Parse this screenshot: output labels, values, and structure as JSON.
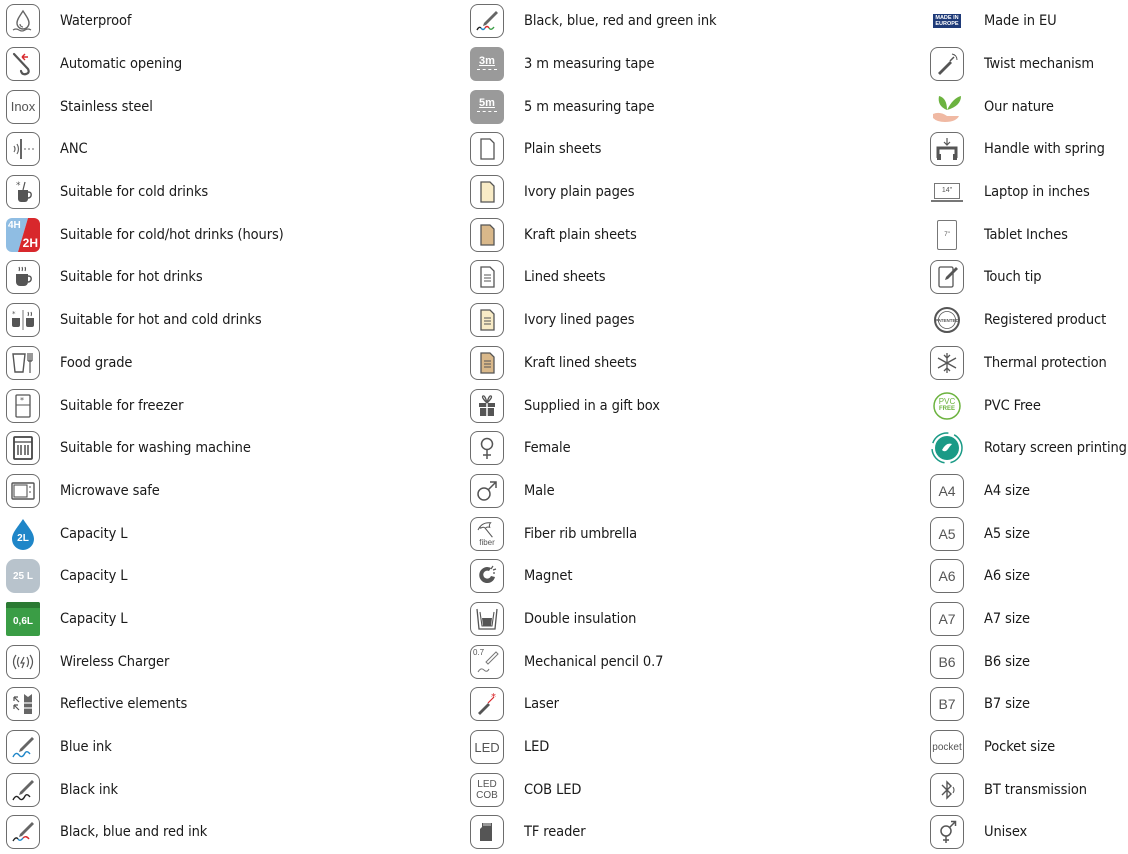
{
  "columns": [
    {
      "items": [
        {
          "icon": "water-drop-icon",
          "label": "Waterproof"
        },
        {
          "icon": "auto-open-umbrella-icon",
          "label": "Automatic opening"
        },
        {
          "icon": "inox-icon",
          "icon_text": "Inox",
          "label": "Stainless steel"
        },
        {
          "icon": "anc-icon",
          "label": "ANC"
        },
        {
          "icon": "cold-drink-icon",
          "label": "Suitable for cold drinks"
        },
        {
          "icon": "cold-hot-hours-icon",
          "icon_text_top": "4H",
          "icon_text_bottom": "2H",
          "label": "Suitable for cold/hot drinks (hours)"
        },
        {
          "icon": "hot-drink-icon",
          "label": "Suitable for hot drinks"
        },
        {
          "icon": "hot-cold-drink-icon",
          "label": "Suitable for hot and cold drinks"
        },
        {
          "icon": "food-grade-icon",
          "label": "Food grade"
        },
        {
          "icon": "freezer-icon",
          "label": "Suitable for freezer"
        },
        {
          "icon": "dishwasher-icon",
          "label": "Suitable for washing machine"
        },
        {
          "icon": "microwave-icon",
          "label": "Microwave safe"
        },
        {
          "icon": "capacity-drop-icon",
          "icon_text": "2L",
          "label": "Capacity L"
        },
        {
          "icon": "capacity-badge-icon",
          "icon_text": "25 L",
          "label": "Capacity L"
        },
        {
          "icon": "capacity-jar-icon",
          "icon_text": "0,6L",
          "label": "Capacity L"
        },
        {
          "icon": "wireless-charger-icon",
          "label": "Wireless Charger"
        },
        {
          "icon": "reflective-vest-icon",
          "label": "Reflective elements"
        },
        {
          "icon": "pen-blue-icon",
          "label": "Blue ink"
        },
        {
          "icon": "pen-black-icon",
          "label": "Black ink"
        },
        {
          "icon": "pen-multi-icon",
          "label": "Black, blue and red ink"
        }
      ]
    },
    {
      "items": [
        {
          "icon": "pen-four-color-icon",
          "label": "Black, blue, red and green ink"
        },
        {
          "icon": "tape-3m-icon",
          "icon_text": "3m",
          "label": "3 m measuring tape"
        },
        {
          "icon": "tape-5m-icon",
          "icon_text": "5m",
          "label": "5 m measuring tape"
        },
        {
          "icon": "plain-sheet-icon",
          "label": "Plain sheets"
        },
        {
          "icon": "ivory-plain-icon",
          "label": "Ivory plain pages"
        },
        {
          "icon": "kraft-plain-icon",
          "label": "Kraft plain sheets"
        },
        {
          "icon": "lined-sheet-icon",
          "label": "Lined sheets"
        },
        {
          "icon": "ivory-lined-icon",
          "label": "Ivory lined pages"
        },
        {
          "icon": "kraft-lined-icon",
          "label": "Kraft lined sheets"
        },
        {
          "icon": "gift-box-icon",
          "label": "Supplied in a gift box"
        },
        {
          "icon": "female-icon",
          "label": "Female"
        },
        {
          "icon": "male-icon",
          "label": "Male"
        },
        {
          "icon": "fiber-umbrella-icon",
          "icon_text": "fiber",
          "label": "Fiber rib umbrella"
        },
        {
          "icon": "magnet-icon",
          "label": "Magnet"
        },
        {
          "icon": "double-insulation-icon",
          "label": "Double insulation"
        },
        {
          "icon": "mechanical-pencil-icon",
          "icon_text": "0.7",
          "label": "Mechanical pencil 0.7"
        },
        {
          "icon": "laser-icon",
          "label": "Laser"
        },
        {
          "icon": "led-icon",
          "icon_text": "LED",
          "label": "LED"
        },
        {
          "icon": "cob-led-icon",
          "icon_text_top": "LED",
          "icon_text_bottom": "COB",
          "label": "COB LED"
        },
        {
          "icon": "tf-card-icon",
          "label": "TF reader"
        }
      ]
    },
    {
      "items": [
        {
          "icon": "made-in-europe-icon",
          "icon_text_top": "MADE IN",
          "icon_text_bottom": "EUROPE",
          "label": "Made in EU"
        },
        {
          "icon": "twist-pen-icon",
          "label": "Twist mechanism"
        },
        {
          "icon": "nature-leaf-icon",
          "label": "Our nature"
        },
        {
          "icon": "handle-spring-icon",
          "label": "Handle with spring"
        },
        {
          "icon": "laptop-inch-icon",
          "icon_text": "14\"",
          "label": "Laptop in inches"
        },
        {
          "icon": "tablet-inch-icon",
          "icon_text": "7\"",
          "label": "Tablet Inches"
        },
        {
          "icon": "touch-tip-icon",
          "label": "Touch tip"
        },
        {
          "icon": "patented-icon",
          "icon_text": "PATENTED",
          "label": "Registered product"
        },
        {
          "icon": "snowflake-icon",
          "label": "Thermal protection"
        },
        {
          "icon": "pvc-free-icon",
          "icon_text_top": "PVC",
          "icon_text_bottom": "FREE",
          "label": "PVC Free"
        },
        {
          "icon": "rotary-print-icon",
          "label": "Rotary screen printing"
        },
        {
          "icon": "a4-icon",
          "icon_text": "A4",
          "label": "A4 size"
        },
        {
          "icon": "a5-icon",
          "icon_text": "A5",
          "label": "A5 size"
        },
        {
          "icon": "a6-icon",
          "icon_text": "A6",
          "label": "A6 size"
        },
        {
          "icon": "a7-icon",
          "icon_text": "A7",
          "label": "A7 size"
        },
        {
          "icon": "b6-icon",
          "icon_text": "B6",
          "label": "B6 size"
        },
        {
          "icon": "b7-icon",
          "icon_text": "B7",
          "label": "B7 size"
        },
        {
          "icon": "pocket-icon",
          "icon_text": "pocket",
          "label": "Pocket size"
        },
        {
          "icon": "bluetooth-icon",
          "label": "BT transmission"
        },
        {
          "icon": "unisex-icon",
          "label": "Unisex"
        }
      ]
    }
  ],
  "colors": {
    "border": "#6d6d6d",
    "text": "#1a1a1a",
    "blue": "#1f86c8",
    "red": "#d8282c",
    "green": "#3a9d45",
    "gray_badge": "#9a9a9a",
    "teal": "#1a9a86",
    "ivory": "#f8ebc6",
    "kraft": "#d9b88a",
    "leaf": "#6cb33f"
  }
}
